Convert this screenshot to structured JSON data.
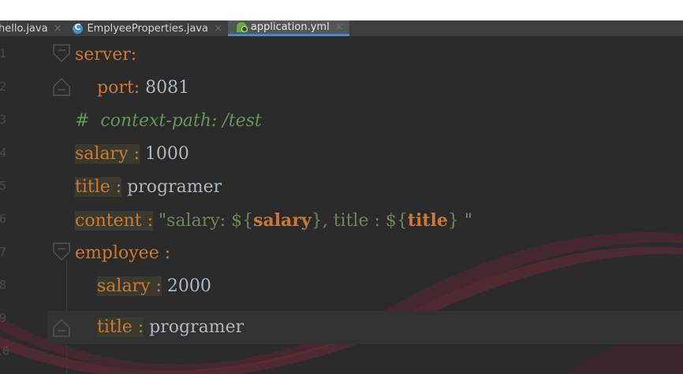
{
  "tabs": [
    {
      "label": "hello.java",
      "close": "×",
      "icon": "none",
      "active": false
    },
    {
      "label": "EmplyeeProperties.java",
      "close": "×",
      "icon": "java-class-icon",
      "active": false
    },
    {
      "label": "application.yml",
      "close": "×",
      "icon": "spring-yml-icon",
      "active": true
    }
  ],
  "gutter": {
    "line_numbers": [
      "1",
      "2",
      "3",
      "4",
      "5",
      "6",
      "7",
      "8",
      "9",
      "10"
    ]
  },
  "code": {
    "l1": {
      "key": "server",
      "colon": ":"
    },
    "l2": {
      "key": "port",
      "colon": ":",
      "value": " 8081"
    },
    "l3": {
      "comment": "#  context-path: /test"
    },
    "l4": {
      "key": "salary",
      "sep": " :",
      "value": " 1000"
    },
    "l5": {
      "key": "title",
      "sep": " :",
      "value": " programer"
    },
    "l6": {
      "key": "content",
      "sep": " :",
      "q1": " \"",
      "s1": "salary: ",
      "d1": "$",
      "ob1": "{",
      "ph1": "salary",
      "cb1": "}",
      "s2": ", title : ",
      "d2": "$",
      "ob2": "{",
      "ph2": "title",
      "cb2": "}",
      "q2": " \""
    },
    "l7": {
      "key": "employee",
      "sep": " :"
    },
    "l8": {
      "key": "salary",
      "sep": " :",
      "value": " 2000"
    },
    "l9": {
      "key": "title",
      "sep": " :",
      "value": " programer"
    }
  },
  "colors": {
    "background": "#2b2b2b",
    "key": "#cc7832",
    "value": "#a9b7c6",
    "comment": "#629755",
    "string": "#6a8759",
    "tab_active_underline": "#4a88c7"
  }
}
